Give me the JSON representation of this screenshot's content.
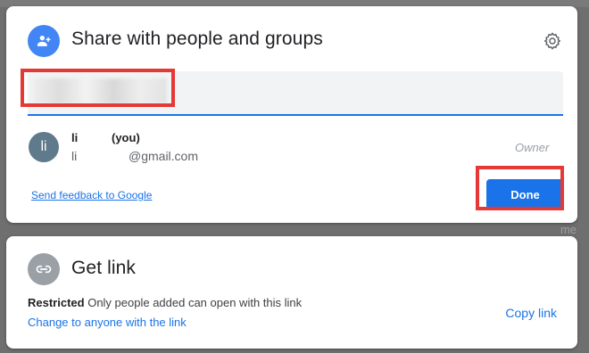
{
  "background": {
    "side_text": "me"
  },
  "share_dialog": {
    "title": "Share with people and groups",
    "search": {
      "value": "",
      "placeholder": ""
    },
    "user": {
      "avatar_initial": "li",
      "name": "li",
      "you_label": "(you)",
      "email_prefix": "li",
      "email_domain": "@gmail.com",
      "role": "Owner"
    },
    "feedback_link": "Send feedback to Google",
    "done_label": "Done"
  },
  "get_link": {
    "title": "Get link",
    "restricted_label": "Restricted",
    "restricted_desc": "Only people added can open with this link",
    "change_link": "Change to anyone with the link",
    "copy_link": "Copy link"
  },
  "colors": {
    "accent": "#1a73e8",
    "header_icon": "#4285f4",
    "highlight": "#e53935"
  }
}
